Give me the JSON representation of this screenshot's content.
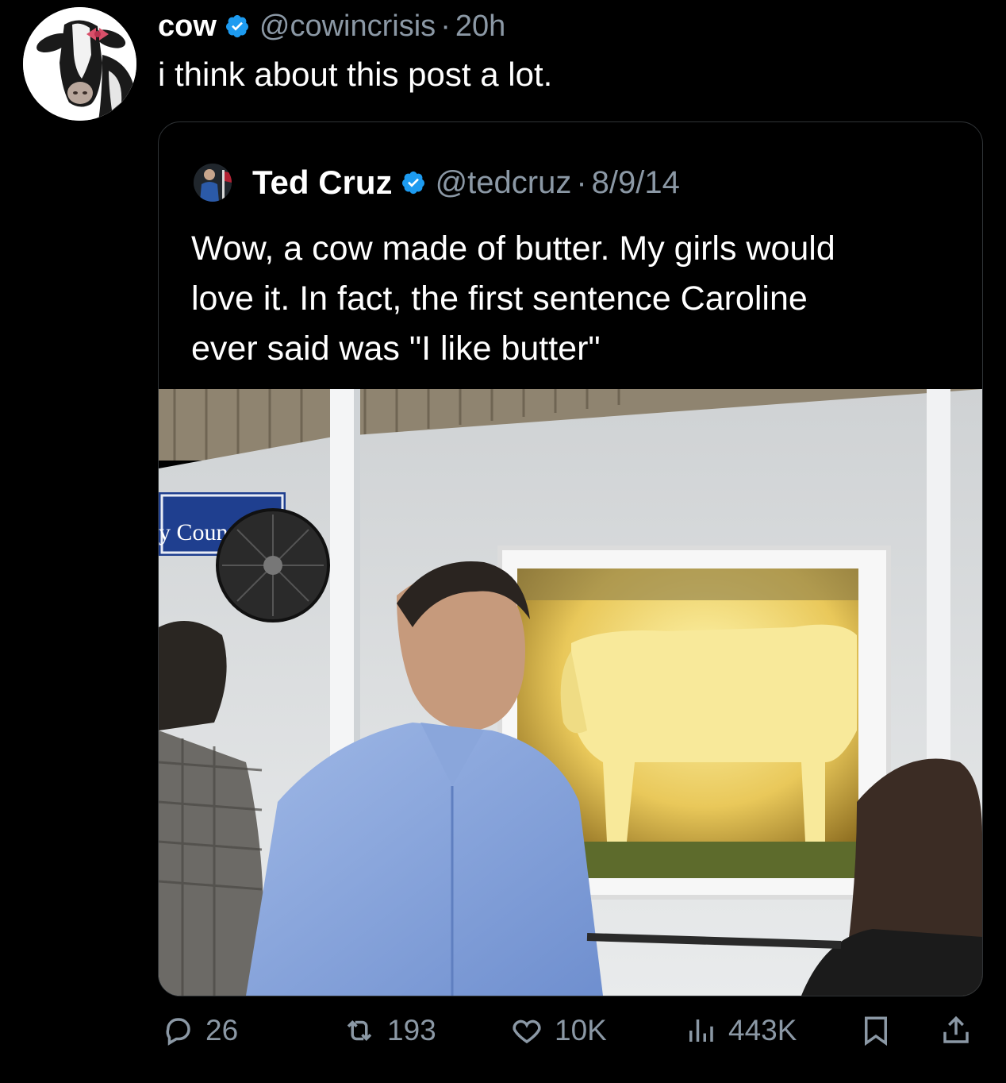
{
  "post": {
    "author_name": "cow",
    "author_handle": "@cowincrisis",
    "separator": "·",
    "time": "20h",
    "text": "i think about this post a lot."
  },
  "quoted": {
    "author_name": "Ted Cruz",
    "author_handle": "@tedcruz",
    "separator": "·",
    "date": "8/9/14",
    "text_lines": [
      "Wow, a cow made of butter. My girls would",
      "love it. In fact, the first sentence Caroline",
      "ever said was \"I like butter\""
    ],
    "photo_sign_text": "y Council"
  },
  "actions": {
    "replies": "26",
    "reposts": "193",
    "likes": "10K",
    "views": "443K"
  },
  "icons": {
    "verified": "verified-badge-icon",
    "reply": "reply-icon",
    "repost": "repost-icon",
    "like": "heart-icon",
    "views": "views-chart-icon",
    "bookmark": "bookmark-icon",
    "share": "share-icon"
  },
  "colors": {
    "background": "#000000",
    "verified": "#1d9bf0",
    "muted_text": "#8b98a5"
  }
}
